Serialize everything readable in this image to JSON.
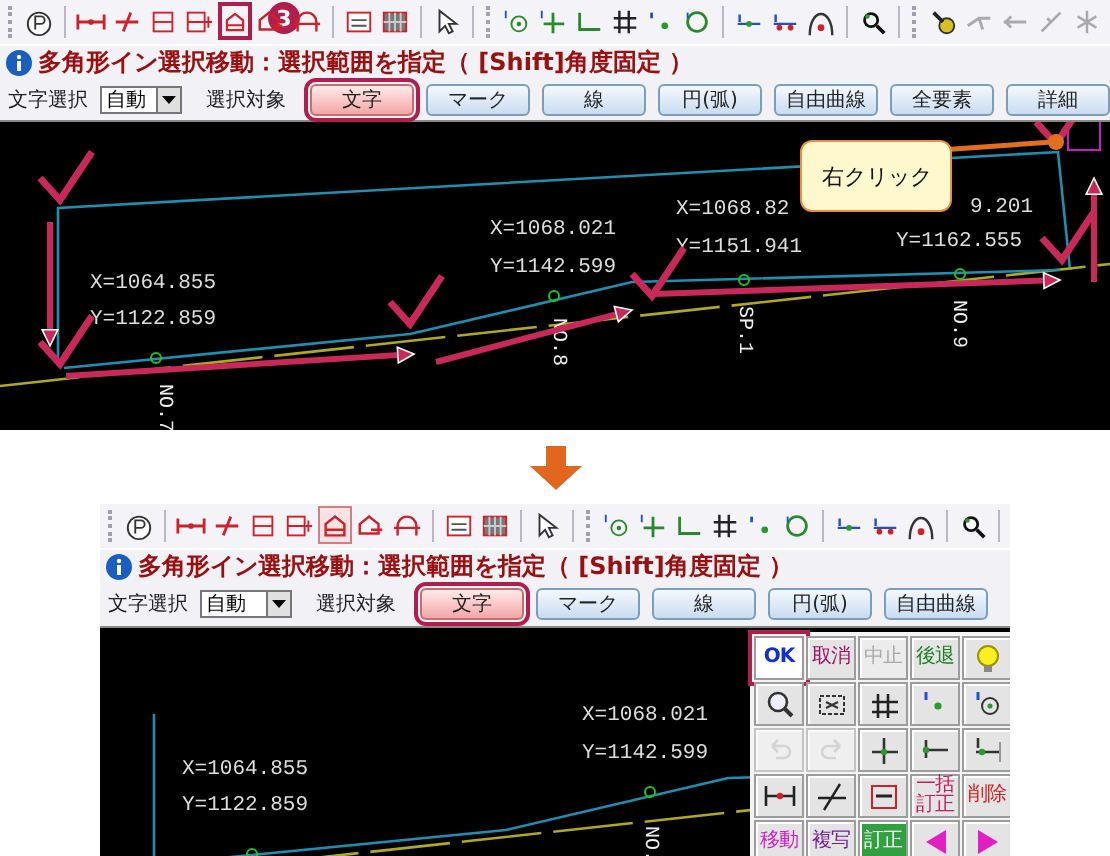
{
  "top_panel": {
    "toolbar": {
      "step_badge": "3",
      "tools": [
        {
          "selected": false
        },
        {
          "selected": false
        },
        {
          "selected": false
        },
        {
          "selected": false
        },
        {
          "selected": false
        },
        {
          "selected": true
        },
        {
          "selected": false
        },
        {
          "selected": false
        },
        {
          "selected": false
        },
        {
          "selected": false
        },
        {
          "selected": false
        },
        {
          "selected": false
        },
        {
          "selected": false
        },
        {
          "selected": false
        },
        {
          "selected": false
        },
        {
          "selected": false
        },
        {
          "selected": false
        },
        {
          "selected": false
        },
        {
          "selected": false
        },
        {
          "selected": false
        },
        {
          "selected": false
        },
        {
          "selected": false
        },
        {
          "selected": false
        },
        {
          "selected": false
        },
        {
          "selected": false
        },
        {
          "selected": false
        }
      ]
    },
    "status": "多角形イン選択移動：選択範囲を指定（ [Shift]角度固定 ）",
    "options": {
      "mode_label": "文字選択",
      "mode_value": "自動",
      "target_label": "選択対象",
      "targets": [
        {
          "label": "文字",
          "selected": true
        },
        {
          "label": "マーク",
          "selected": false
        },
        {
          "label": "線",
          "selected": false
        },
        {
          "label": "円(弧)",
          "selected": false
        },
        {
          "label": "自由曲線",
          "selected": false
        },
        {
          "label": "全要素",
          "selected": false
        },
        {
          "label": "詳細",
          "selected": false
        }
      ]
    },
    "canvas": {
      "labels": [
        "X=1064.855",
        "Y=1122.859",
        "X=1068.021",
        "Y=1142.599",
        "X=1068.82",
        "Y=1151.941",
        "9.201",
        "Y=1162.555"
      ],
      "stations": [
        "NO.7",
        "NO.8",
        "SP.1",
        "NO.9"
      ],
      "callout": "右クリック"
    }
  },
  "bottom_panel": {
    "toolbar": {
      "tools": [
        {
          "selected": false
        },
        {
          "selected": false
        },
        {
          "selected": false
        },
        {
          "selected": false
        },
        {
          "selected": false
        },
        {
          "selected": true
        },
        {
          "selected": false
        },
        {
          "selected": false
        },
        {
          "selected": false
        },
        {
          "selected": false
        },
        {
          "selected": false
        },
        {
          "selected": false
        },
        {
          "selected": false
        },
        {
          "selected": false
        },
        {
          "selected": false
        },
        {
          "selected": false
        },
        {
          "selected": false
        },
        {
          "selected": false
        },
        {
          "selected": false
        },
        {
          "selected": false
        },
        {
          "selected": false
        }
      ]
    },
    "status": "多角形イン選択移動：選択範囲を指定（ [Shift]角度固定 ）",
    "options": {
      "mode_label": "文字選択",
      "mode_value": "自動",
      "target_label": "選択対象",
      "targets": [
        {
          "label": "文字",
          "selected": true
        },
        {
          "label": "マーク",
          "selected": false
        },
        {
          "label": "線",
          "selected": false
        },
        {
          "label": "円(弧)",
          "selected": false
        },
        {
          "label": "自由曲線",
          "selected": false
        }
      ]
    },
    "canvas": {
      "labels": [
        "X=1064.855",
        "Y=1122.859",
        "X=1068.021",
        "Y=1142.599"
      ],
      "stations": [
        "NO."
      ]
    },
    "palette": [
      {
        "kind": "text",
        "label": "OK",
        "framed": true,
        "disabled": false
      },
      {
        "kind": "text",
        "label": "取消",
        "framed": false,
        "disabled": false
      },
      {
        "kind": "text",
        "label": "中止",
        "framed": false,
        "disabled": true
      },
      {
        "kind": "text",
        "label": "後退",
        "framed": false,
        "disabled": false
      },
      {
        "kind": "icon",
        "framed": false,
        "disabled": false
      },
      {
        "kind": "icon",
        "framed": false,
        "disabled": false
      },
      {
        "kind": "icon",
        "framed": false,
        "disabled": false
      },
      {
        "kind": "icon",
        "framed": false,
        "disabled": false
      },
      {
        "kind": "icon",
        "framed": false,
        "disabled": false
      },
      {
        "kind": "icon",
        "framed": false,
        "disabled": false
      },
      {
        "kind": "icon",
        "framed": false,
        "disabled": true
      },
      {
        "kind": "icon",
        "framed": false,
        "disabled": true
      },
      {
        "kind": "icon",
        "framed": false,
        "disabled": false
      },
      {
        "kind": "icon",
        "framed": false,
        "disabled": false
      },
      {
        "kind": "icon",
        "framed": false,
        "disabled": false
      },
      {
        "kind": "icon",
        "framed": false,
        "disabled": false
      },
      {
        "kind": "icon",
        "framed": false,
        "disabled": false
      },
      {
        "kind": "icon",
        "framed": false,
        "disabled": false
      },
      {
        "kind": "text",
        "label": "一括訂正",
        "framed": false,
        "disabled": false
      },
      {
        "kind": "text",
        "label": "削除",
        "framed": false,
        "disabled": false
      },
      {
        "kind": "text",
        "label": "移動",
        "framed": false,
        "disabled": false
      },
      {
        "kind": "text",
        "label": "複写",
        "framed": false,
        "disabled": false
      },
      {
        "kind": "text",
        "label": "訂正",
        "framed": false,
        "disabled": false
      },
      {
        "kind": "icon",
        "framed": false,
        "disabled": false
      },
      {
        "kind": "icon",
        "framed": false,
        "disabled": false
      }
    ]
  }
}
